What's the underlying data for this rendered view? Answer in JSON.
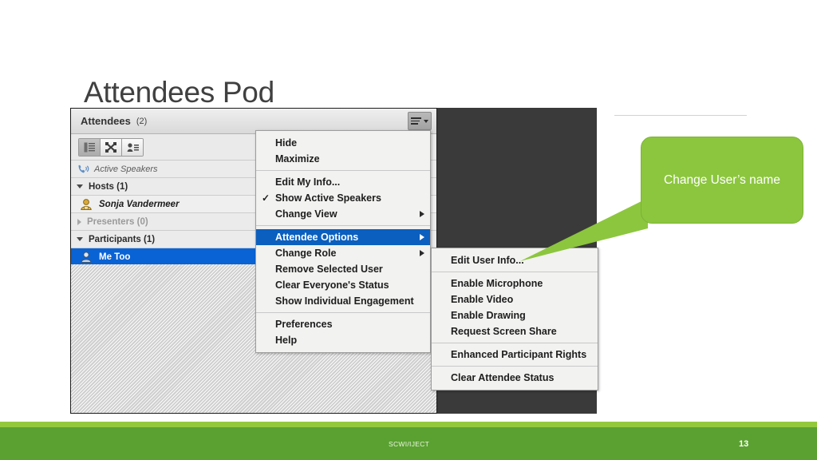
{
  "slide": {
    "title": "Attendees Pod",
    "footer_text": "SCWI/IJECT",
    "page_number": "13",
    "accent_green": "#8CC63E",
    "footer_green": "#5AA131",
    "footer_lime": "#93C83D",
    "highlight_blue": "#0B5FBE"
  },
  "callout": {
    "text": "Change User’s name"
  },
  "pod": {
    "title": "Attendees",
    "count": "(2)",
    "menu_button_icon": "hamburger-icon",
    "toolbar": [
      {
        "name": "list-view-icon",
        "selected": true
      },
      {
        "name": "breakout-view-icon",
        "selected": false
      },
      {
        "name": "status-view-icon",
        "selected": false
      }
    ],
    "active_speakers_label": "Active Speakers",
    "active_speakers_icon": "phone-speaker-icon",
    "groups": [
      {
        "label": "Hosts (1)",
        "expanded": true,
        "dim": false,
        "members": [
          {
            "name": "Sonja Vandermeer",
            "icon": "host-avatar-icon",
            "selected": false
          }
        ]
      },
      {
        "label": "Presenters (0)",
        "expanded": false,
        "dim": true,
        "members": []
      },
      {
        "label": "Participants (1)",
        "expanded": true,
        "dim": false,
        "members": [
          {
            "name": "Me Too",
            "icon": "participant-avatar-icon",
            "selected": true
          }
        ]
      }
    ]
  },
  "menu_main": {
    "groups": [
      {
        "items": [
          {
            "label": "Hide",
            "submenu": false,
            "checked": false,
            "highlighted": false
          },
          {
            "label": "Maximize",
            "submenu": false,
            "checked": false,
            "highlighted": false
          }
        ]
      },
      {
        "items": [
          {
            "label": "Edit My Info...",
            "submenu": false,
            "checked": false,
            "highlighted": false
          },
          {
            "label": "Show Active Speakers",
            "submenu": false,
            "checked": true,
            "highlighted": false
          },
          {
            "label": "Change View",
            "submenu": true,
            "checked": false,
            "highlighted": false
          }
        ]
      },
      {
        "items": [
          {
            "label": "Attendee Options",
            "submenu": true,
            "checked": false,
            "highlighted": true
          },
          {
            "label": "Change Role",
            "submenu": true,
            "checked": false,
            "highlighted": false
          },
          {
            "label": "Remove Selected User",
            "submenu": false,
            "checked": false,
            "highlighted": false
          },
          {
            "label": "Clear Everyone's Status",
            "submenu": false,
            "checked": false,
            "highlighted": false
          },
          {
            "label": "Show Individual Engagement",
            "submenu": false,
            "checked": false,
            "highlighted": false
          }
        ]
      },
      {
        "items": [
          {
            "label": "Preferences",
            "submenu": false,
            "checked": false,
            "highlighted": false
          },
          {
            "label": "Help",
            "submenu": false,
            "checked": false,
            "highlighted": false
          }
        ]
      }
    ]
  },
  "menu_sub": {
    "groups": [
      {
        "items": [
          {
            "label": "Edit User Info...",
            "submenu": false,
            "checked": false,
            "highlighted": false
          }
        ]
      },
      {
        "items": [
          {
            "label": "Enable Microphone",
            "submenu": false,
            "checked": false,
            "highlighted": false
          },
          {
            "label": "Enable Video",
            "submenu": false,
            "checked": false,
            "highlighted": false
          },
          {
            "label": "Enable Drawing",
            "submenu": false,
            "checked": false,
            "highlighted": false
          },
          {
            "label": "Request Screen Share",
            "submenu": false,
            "checked": false,
            "highlighted": false
          }
        ]
      },
      {
        "items": [
          {
            "label": "Enhanced Participant Rights",
            "submenu": false,
            "checked": false,
            "highlighted": false
          }
        ]
      },
      {
        "items": [
          {
            "label": "Clear Attendee Status",
            "submenu": false,
            "checked": false,
            "highlighted": false
          }
        ]
      }
    ]
  },
  "check_glyph": "✓"
}
